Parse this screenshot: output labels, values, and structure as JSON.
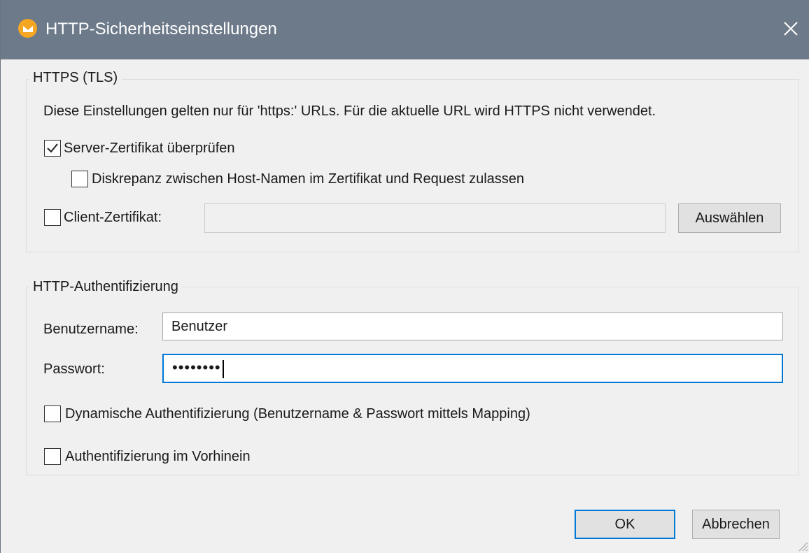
{
  "window": {
    "title": "HTTP-Sicherheitseinstellungen",
    "app_icon": "altova-mapforce-icon",
    "close_icon": "close-icon",
    "accent_color": "#0078d7",
    "titlebar_color": "#6d7a8a"
  },
  "https_group": {
    "legend": "HTTPS (TLS)",
    "description": "Diese Einstellungen gelten nur für 'https:' URLs. Für die aktuelle URL wird HTTPS nicht verwendet.",
    "verify_server_cert": {
      "label": "Server-Zertifikat überprüfen",
      "checked": true
    },
    "allow_host_mismatch": {
      "label": "Diskrepanz zwischen Host-Namen im Zertifikat und Request zulassen",
      "checked": false
    },
    "client_cert": {
      "label": "Client-Zertifikat:",
      "checked": false,
      "value": ""
    },
    "select_button": "Auswählen"
  },
  "auth_group": {
    "legend": "HTTP-Authentifizierung",
    "username": {
      "label": "Benutzername:",
      "value": "Benutzer"
    },
    "password": {
      "label": "Passwort:",
      "masked_value": "••••••••"
    },
    "dynamic_auth": {
      "label": "Dynamische Authentifizierung (Benutzername & Passwort mittels Mapping)",
      "checked": false
    },
    "preemptive_auth": {
      "label": "Authentifizierung im Vorhinein",
      "checked": false
    }
  },
  "footer": {
    "ok_label": "OK",
    "cancel_label": "Abbrechen"
  }
}
